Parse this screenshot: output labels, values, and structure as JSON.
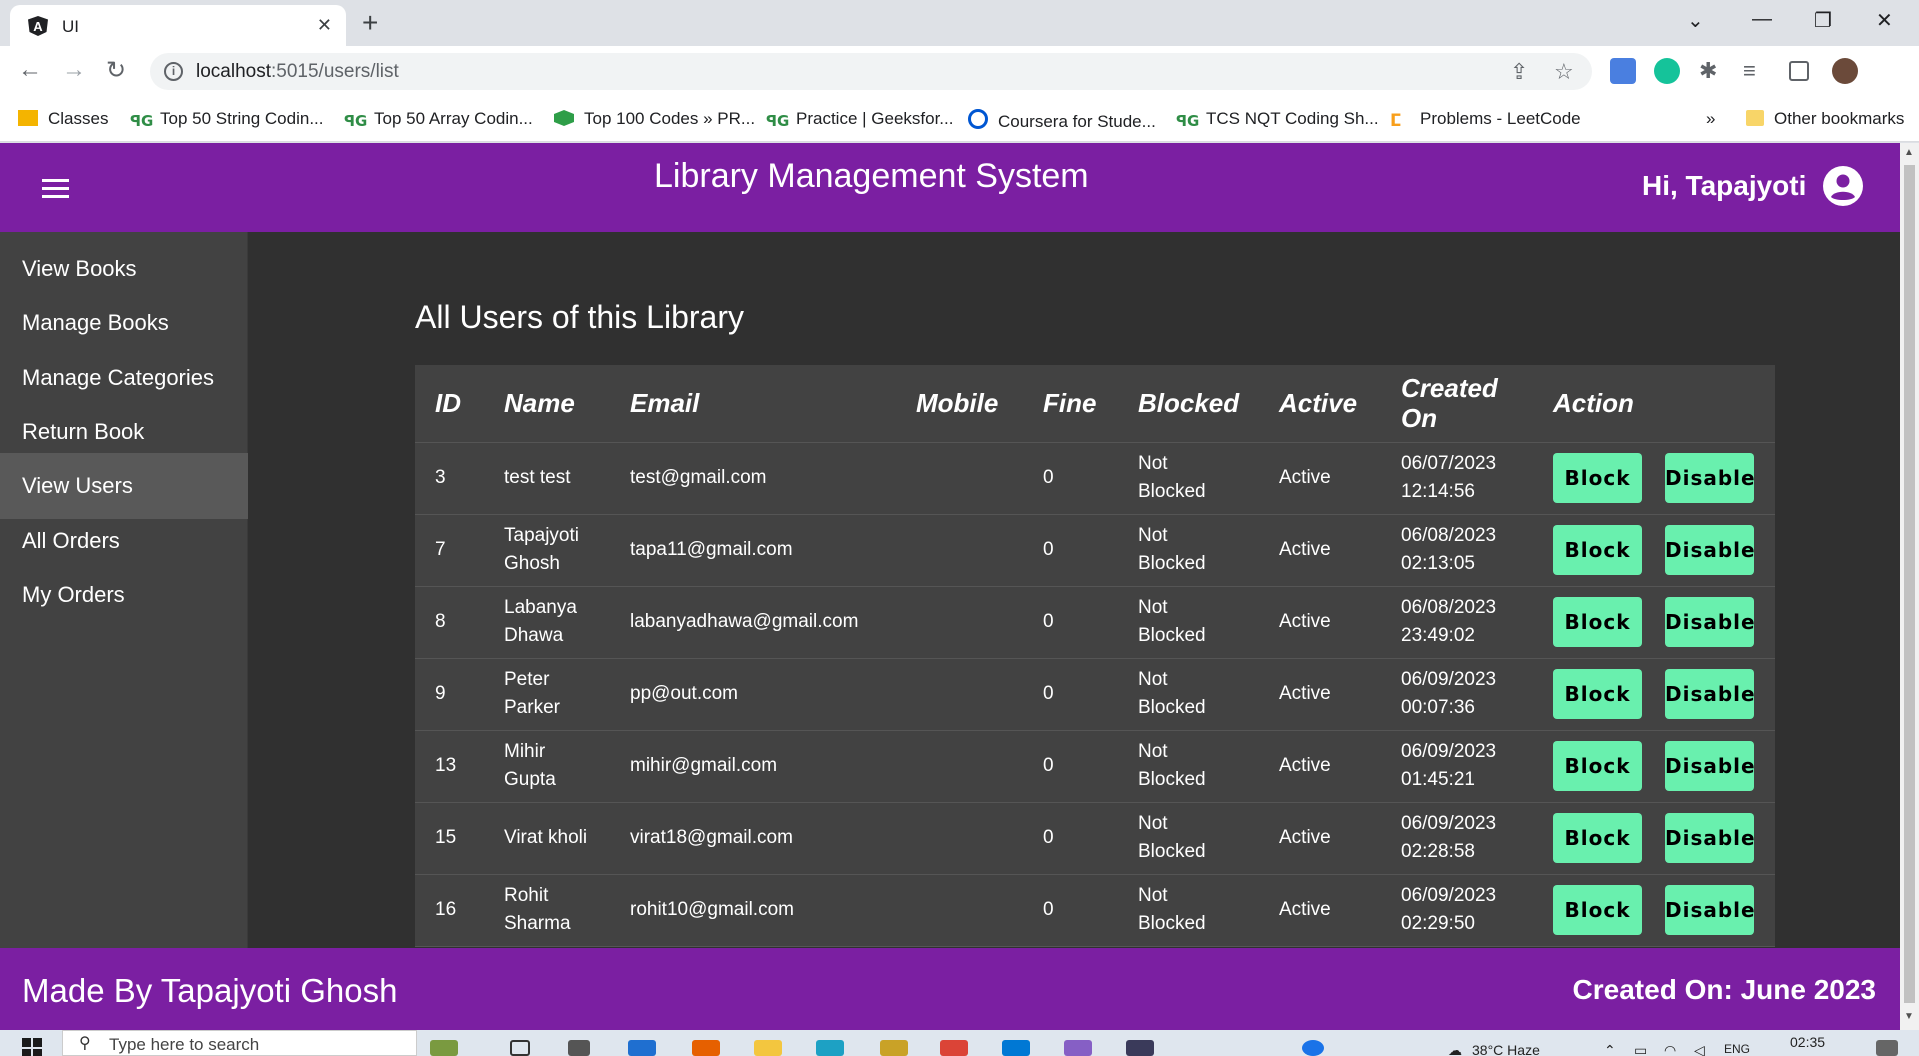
{
  "browser": {
    "tab_title": "UI",
    "url_host": "localhost",
    "url_rest": ":5015/users/list",
    "bookmarks": [
      {
        "label": "Classes",
        "icon": "classroom-icon"
      },
      {
        "label": "Top 50 String Codin...",
        "icon": "gfg-icon"
      },
      {
        "label": "Top 50 Array Codin...",
        "icon": "gfg-icon"
      },
      {
        "label": "Top 100 Codes » PR...",
        "icon": "hexagon-icon"
      },
      {
        "label": "Practice | Geeksfor...",
        "icon": "gfg-icon"
      },
      {
        "label": "Coursera for Stude...",
        "icon": "coursera-icon"
      },
      {
        "label": "TCS NQT Coding Sh...",
        "icon": "gfg-icon"
      },
      {
        "label": "Problems - LeetCode",
        "icon": "leetcode-icon"
      }
    ],
    "more_bookmarks": "»",
    "other_bookmarks": "Other bookmarks"
  },
  "app": {
    "title": "Library Management System",
    "greeting": "Hi, Tapajyoti",
    "sidebar": [
      {
        "label": "View Books",
        "active": false
      },
      {
        "label": "Manage Books",
        "active": false
      },
      {
        "label": "Manage Categories",
        "active": false
      },
      {
        "label": "Return Book",
        "active": false
      },
      {
        "label": "View Users",
        "active": true
      },
      {
        "label": "All Orders",
        "active": false
      },
      {
        "label": "My Orders",
        "active": false
      }
    ],
    "heading": "All Users of this Library",
    "table": {
      "headers": {
        "id": "ID",
        "name": "Name",
        "email": "Email",
        "mobile": "Mobile",
        "fine": "Fine",
        "blocked": "Blocked",
        "active": "Active",
        "created": "Created On",
        "action": "Action"
      },
      "rows": [
        {
          "id": "3",
          "name": "test test",
          "email": "test@gmail.com",
          "mobile": "",
          "fine": "0",
          "blocked": "Not Blocked",
          "active": "Active",
          "created": "06/07/2023 12:14:56"
        },
        {
          "id": "7",
          "name": "Tapajyoti Ghosh",
          "email": "tapa11@gmail.com",
          "mobile": "",
          "fine": "0",
          "blocked": "Not Blocked",
          "active": "Active",
          "created": "06/08/2023 02:13:05"
        },
        {
          "id": "8",
          "name": "Labanya Dhawa",
          "email": "labanyadhawa@gmail.com",
          "mobile": "",
          "fine": "0",
          "blocked": "Not Blocked",
          "active": "Active",
          "created": "06/08/2023 23:49:02"
        },
        {
          "id": "9",
          "name": "Peter Parker",
          "email": "pp@out.com",
          "mobile": "",
          "fine": "0",
          "blocked": "Not Blocked",
          "active": "Active",
          "created": "06/09/2023 00:07:36"
        },
        {
          "id": "13",
          "name": "Mihir Gupta",
          "email": "mihir@gmail.com",
          "mobile": "",
          "fine": "0",
          "blocked": "Not Blocked",
          "active": "Active",
          "created": "06/09/2023 01:45:21"
        },
        {
          "id": "15",
          "name": "Virat kholi",
          "email": "virat18@gmail.com",
          "mobile": "",
          "fine": "0",
          "blocked": "Not Blocked",
          "active": "Active",
          "created": "06/09/2023 02:28:58"
        },
        {
          "id": "16",
          "name": "Rohit Sharma",
          "email": "rohit10@gmail.com",
          "mobile": "",
          "fine": "0",
          "blocked": "Not Blocked",
          "active": "Active",
          "created": "06/09/2023 02:29:50"
        }
      ],
      "block_label": "Block",
      "disable_label": "Disable"
    },
    "footer_left": "Made By Tapajyoti Ghosh",
    "footer_right": "Created On: June 2023"
  },
  "taskbar": {
    "search_placeholder": "Type here to search",
    "weather": "38°C  Haze",
    "language": "ENG",
    "time": "02:35"
  },
  "colors": {
    "header_purple": "#7b1fa2",
    "button_green": "#69f0ae",
    "sidebar_bg": "#424242",
    "content_bg": "#303030"
  }
}
